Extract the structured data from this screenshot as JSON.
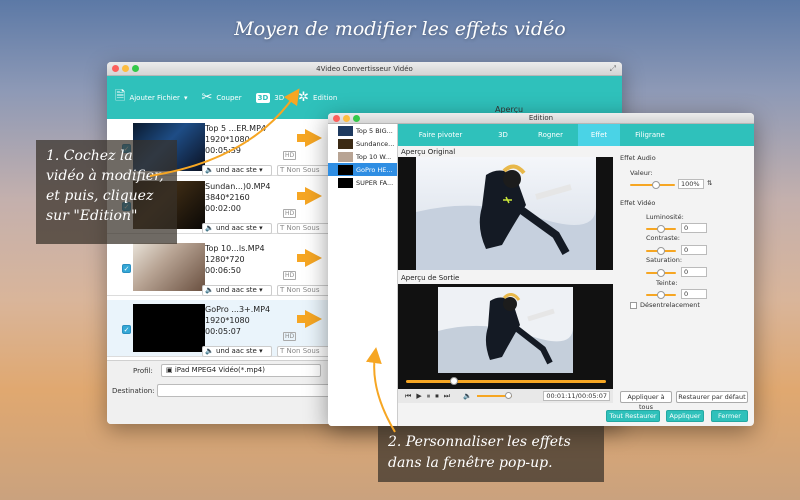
{
  "headline": "Moyen de modifier les effets vidéo",
  "main_window": {
    "title": "4Video Convertisseur Vidéo",
    "toolbar": {
      "add_file": "Ajouter Fichier",
      "cut": "Couper",
      "three_d_chip": "3D",
      "three_d": "3D",
      "edit": "Edition"
    },
    "side_label": "Aperçu",
    "files": [
      {
        "name": "Top 5 ...ER.MP4",
        "resolution": "1920*1080",
        "duration": "00:05:39",
        "audio": "und aac ste",
        "subtitle": "Non Sous",
        "checked": true
      },
      {
        "name": "Sundan...)0.MP4",
        "resolution": "3840*2160",
        "duration": "00:02:00",
        "audio": "und aac ste",
        "subtitle": "Non Sous",
        "checked": true
      },
      {
        "name": "Top 10...ls.MP4",
        "resolution": "1280*720",
        "duration": "00:06:50",
        "audio": "und aac ste",
        "subtitle": "Non Sous",
        "checked": true
      },
      {
        "name": "GoPro ...3+.MP4",
        "resolution": "1920*1080",
        "duration": "00:05:07",
        "audio": "und aac ste",
        "subtitle": "Non Sous",
        "checked": true
      }
    ],
    "hd_badge": "HD",
    "profile_label": "Profil:",
    "profile_value": "iPad MPEG4 Vidéo(*.mp4)",
    "destination_label": "Destination:"
  },
  "edition": {
    "title": "Edition",
    "files": [
      "Top 5 BIG...",
      "Sundance...",
      "Top 10 W...",
      "GoPro HE...",
      "SUPER FA..."
    ],
    "selected_index": 3,
    "tabs": [
      "Faire pivoter",
      "3D",
      "Rogner",
      "Effet",
      "Filigrane"
    ],
    "active_tab": "Effet",
    "original_label": "Aperçu Original",
    "output_label": "Aperçu de Sortie",
    "playback_progress": 0.22,
    "time": "00:01:11/00:05:07",
    "audio_effect_label": "Effet Audio",
    "volume_label": "Valeur:",
    "volume_value": "100%",
    "video_effect_label": "Effet Vidéo",
    "brightness_label": "Luminosité:",
    "brightness_value": "0",
    "contrast_label": "Contraste:",
    "contrast_value": "0",
    "saturation_label": "Saturation:",
    "saturation_value": "0",
    "hue_label": "Teinte:",
    "hue_value": "0",
    "deinterlace_label": "Désentrelacement",
    "apply_all": "Appliquer à tous",
    "restore_default": "Restaurer par défaut",
    "restore_all": "Tout Restaurer",
    "apply": "Appliquer",
    "close": "Fermer"
  },
  "callout1": [
    "1. Cochez la",
    "vidéo à modifier,",
    "et puis, cliquez",
    "sur \"Edition\""
  ],
  "callout2": [
    "2. Personnaliser les effets",
    "dans la fenêtre pop-up."
  ],
  "colors": {
    "accent": "#2fc1bb",
    "arrow": "#f6a623",
    "selection": "#2f8ee3"
  }
}
